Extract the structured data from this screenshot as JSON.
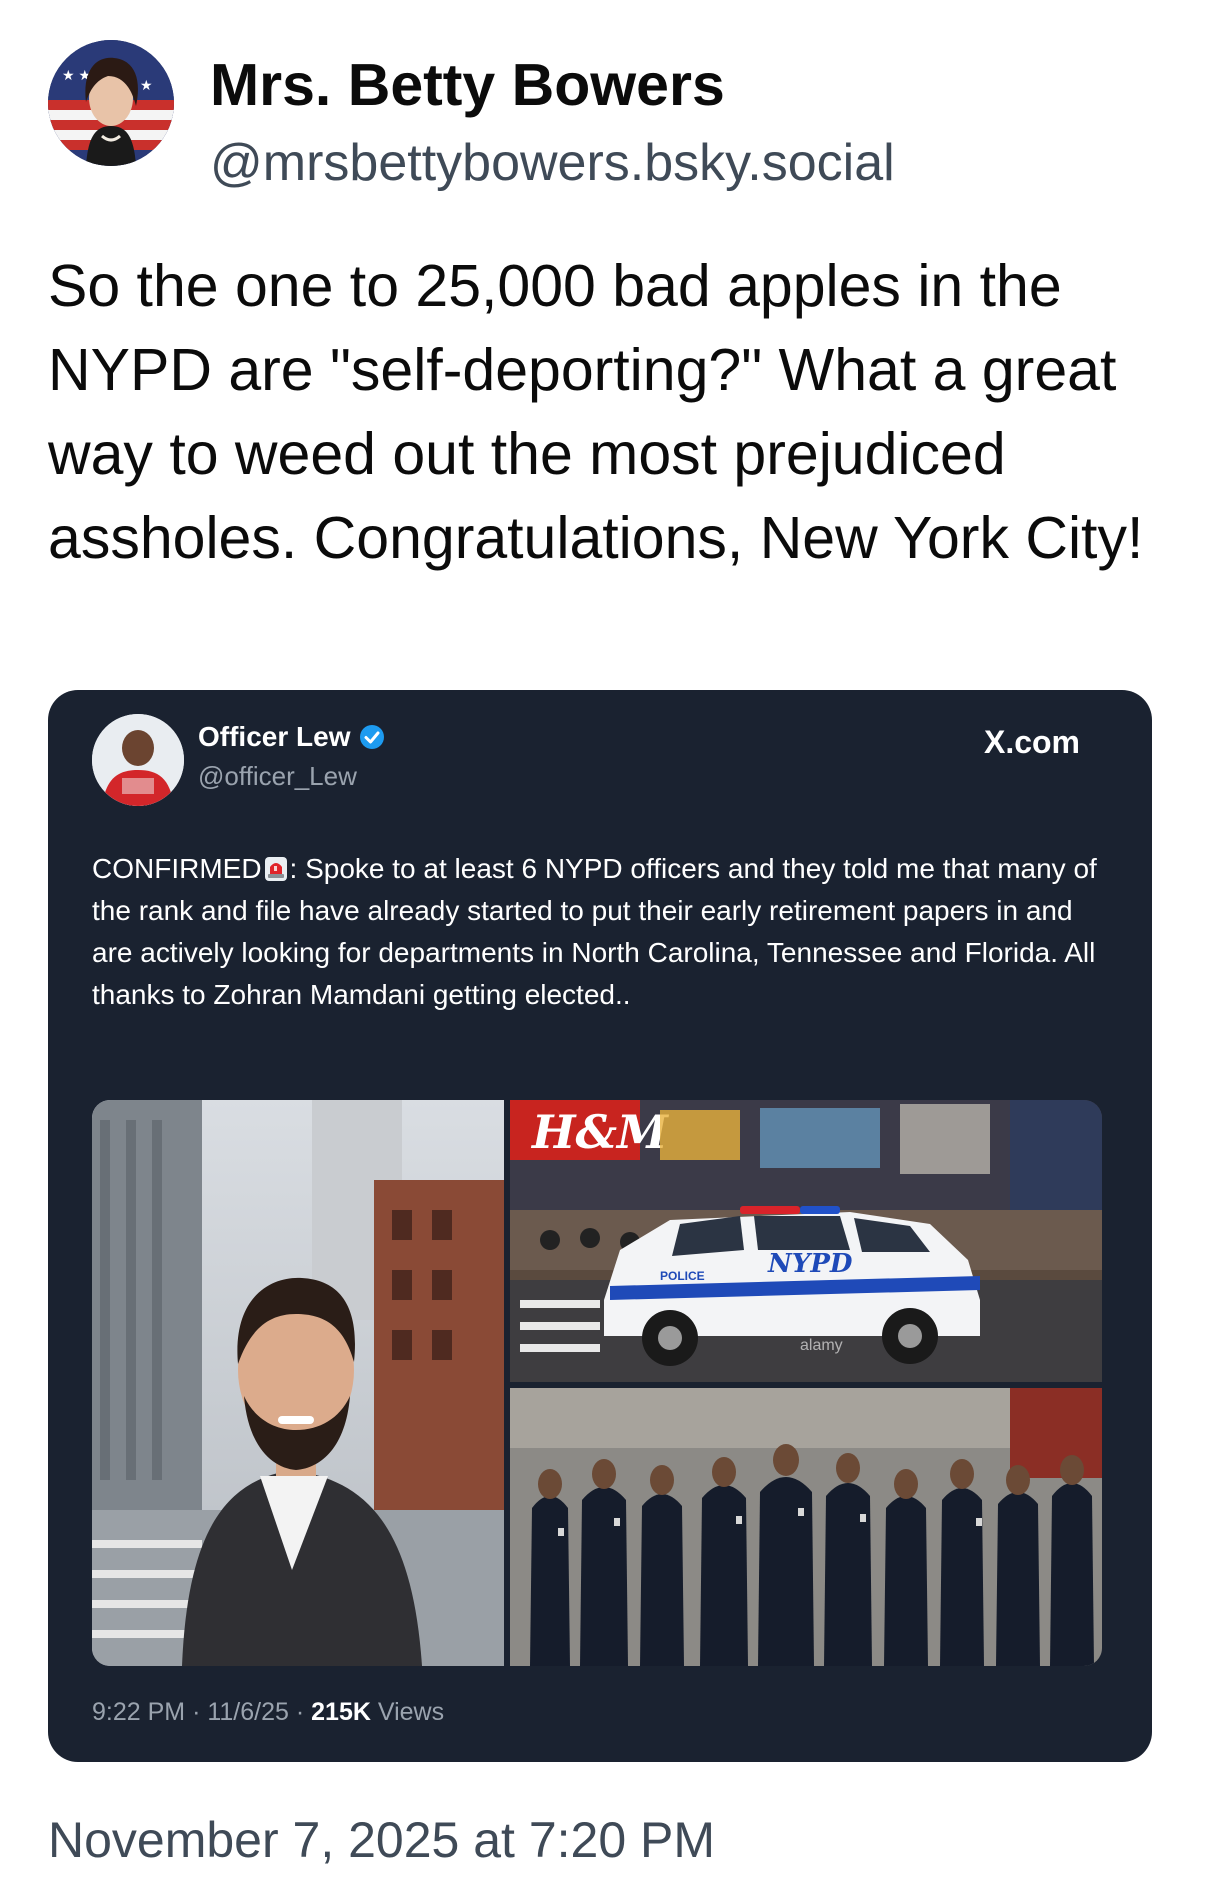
{
  "post": {
    "author_name": "Mrs. Betty Bowers",
    "author_handle": "@mrsbettybowers.bsky.social",
    "text": "So the one to 25,000 bad apples in the NYPD are \"self-deporting?\" What a great way to weed out the most prejudiced assholes. Congratulations, New York City!",
    "timestamp": "November 7, 2025 at 7:20 PM"
  },
  "embed": {
    "author_name": "Officer Lew",
    "author_handle": "@officer_Lew",
    "source": "X.com",
    "text_before_emoji": "CONFIRMED",
    "emoji": "police-siren-emoji",
    "text_after_emoji": ": Spoke to at least 6  NYPD officers and they told me that many of the rank and file have already started to put their early retirement papers in and are actively looking for departments in North Carolina, Tennessee and Florida. All thanks to Zohran Mamdani getting elected..",
    "time": "9:22 PM",
    "date": "11/6/25",
    "separator": "·",
    "views_count": "215K",
    "views_label": "Views",
    "images": {
      "car_logo": "NYPD",
      "car_label": "POLICE",
      "store_sign": "H&M",
      "watermark": "alamy"
    }
  },
  "colors": {
    "embed_background": "#1a2230",
    "verified_badge": "#1d9bf0",
    "handle_gray": "#3f4a57"
  }
}
